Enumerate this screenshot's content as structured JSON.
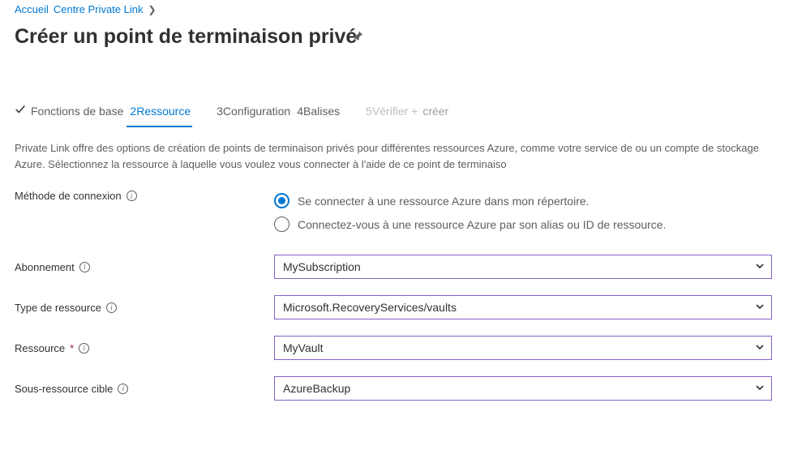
{
  "breadcrumb": {
    "home": "Accueil",
    "center": "Centre Private Link"
  },
  "title": "Créer un point de terminaison privé",
  "tabs": {
    "t1": "Fonctions de base",
    "t2_num": "2",
    "t2": "Ressource",
    "t3_num": "3",
    "t3": "Configuration",
    "t4_num": "4",
    "t4": "Balises",
    "t5_num": "5",
    "t5": "Vérifier +",
    "t5b": "créer"
  },
  "description": "Private Link offre des options de création de points de terminaison privés pour différentes ressources Azure, comme votre service de ou un compte de stockage Azure. Sélectionnez la ressource à laquelle vous voulez vous connecter à l'aide de ce point de terminaiso",
  "form": {
    "connection_method_label": "Méthode de connexion",
    "radio1": "Se connecter à une ressource Azure dans mon répertoire.",
    "radio2": "Connectez-vous à une ressource Azure par son alias ou ID de ressource.",
    "subscription_label": "Abonnement",
    "subscription_value": "MySubscription",
    "resource_type_label": "Type de ressource",
    "resource_type_value": "Microsoft.RecoveryServices/vaults",
    "resource_label": "Ressource",
    "resource_value": "MyVault",
    "subresource_label": "Sous-ressource cible",
    "subresource_value": "AzureBackup"
  }
}
